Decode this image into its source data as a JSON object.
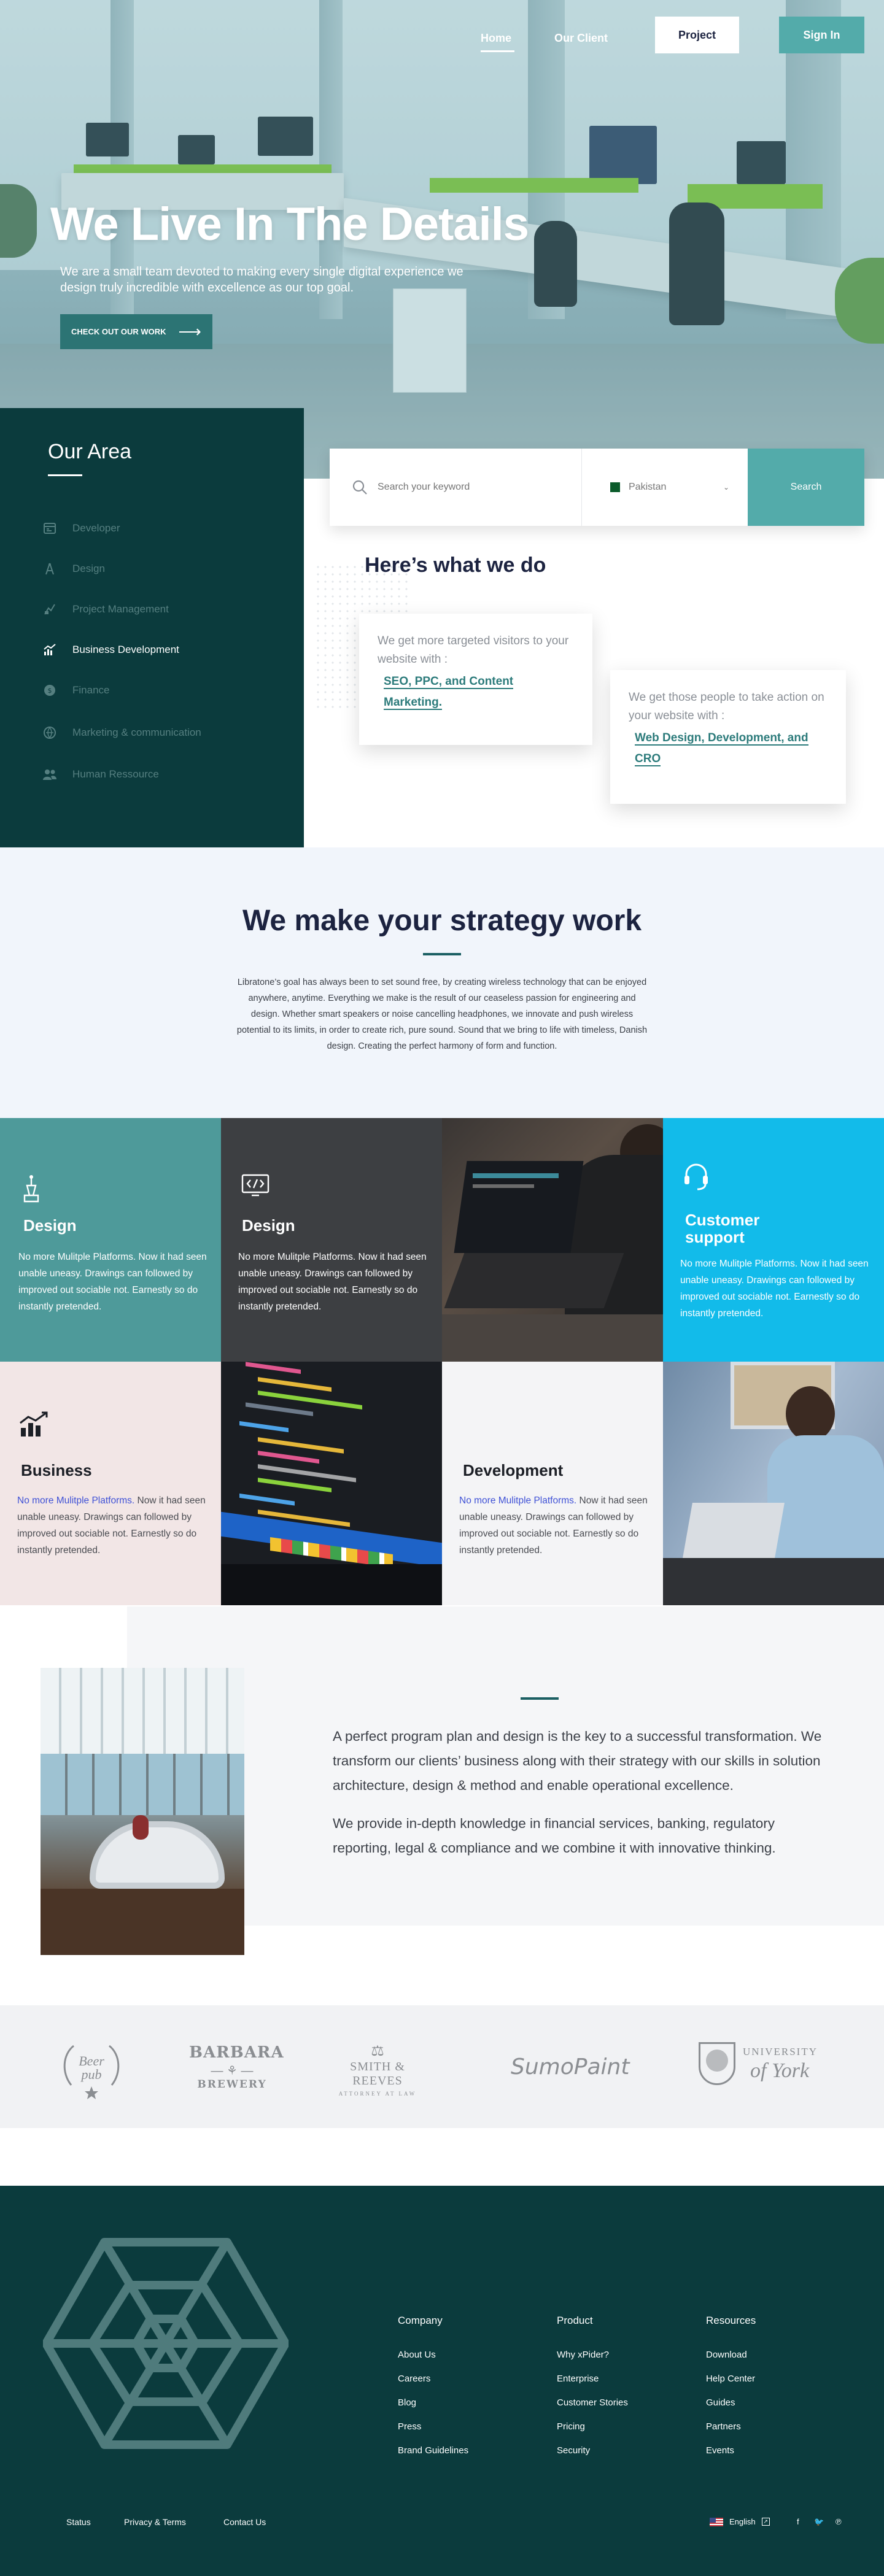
{
  "nav": {
    "home": "Home",
    "our_client": "Our Client",
    "project": "Project",
    "sign_in": "Sign In"
  },
  "hero": {
    "title": "We Live In The Details",
    "subtitle": "We are a small team devoted to making every single digital experience we design truly incredible with excellence as our top goal.",
    "cta": "CHECK OUT OUR WORK"
  },
  "area": {
    "title": "Our Area",
    "items": [
      {
        "label": "Developer",
        "icon": "developer-icon",
        "active": false
      },
      {
        "label": "Design",
        "icon": "design-icon",
        "active": false
      },
      {
        "label": "Project Management",
        "icon": "project-management-icon",
        "active": false
      },
      {
        "label": "Business Development",
        "icon": "chart-icon",
        "active": true
      },
      {
        "label": "Finance",
        "icon": "finance-icon",
        "active": false
      },
      {
        "label": "Marketing & communication",
        "icon": "marketing-icon",
        "active": false
      },
      {
        "label": "Human Ressource",
        "icon": "people-icon",
        "active": false
      }
    ]
  },
  "search": {
    "placeholder": "Search your keyword",
    "country": "Pakistan",
    "button": "Search"
  },
  "what": {
    "title": "Here’s what we do",
    "card1_text": "We get more targeted visitors to your website with :",
    "card1_link": "SEO, PPC, and Content Marketing.",
    "card2_text": "We get those people to take action on your website with :",
    "card2_link": "Web Design, Development, and CRO"
  },
  "strategy": {
    "title": "We make your strategy work",
    "body": "Libratone’s goal has always been to set sound free, by creating wireless technology that can be enjoyed anywhere, anytime. Everything we make is the result of our ceaseless passion for engineering and design. Whether smart speakers or noise cancelling headphones, we innovate and push wireless potential to its limits, in order to create rich, pure sound. Sound that we bring to life with timeless, Danish design. Creating the perfect harmony of form and function."
  },
  "services": {
    "design1": {
      "title": "Design",
      "text": "No more Mulitple Platforms. Now it had seen unable uneasy. Drawings can followed by improved out sociable not. Earnestly so do instantly pretended."
    },
    "design2": {
      "title": "Design",
      "text": "No more Mulitple Platforms. Now it had seen unable uneasy. Drawings can followed by improved out sociable not. Earnestly so do instantly pretended."
    },
    "support": {
      "title": "Customer support",
      "text": "No more Mulitple Platforms. Now it had seen unable uneasy. Drawings can followed by improved out sociable not. Earnestly so do instantly pretended."
    },
    "business": {
      "title": "Business",
      "highlight": "No more Mulitple Platforms.",
      "text": " Now it had seen unable uneasy. Drawings can followed by improved out sociable not. Earnestly so do instantly pretended."
    },
    "development": {
      "title": "Development",
      "highlight": "No more Mulitple Platforms.",
      "text": " Now it had seen unable uneasy. Drawings can followed by improved out sociable not. Earnestly so do instantly pretended."
    }
  },
  "about": {
    "p1": "A perfect program plan and design is the key to a successful transformation. We transform our clients’ business along with their strategy with our skills in solution architecture, design & method and enable operational excellence.",
    "p2": "We provide in-depth knowledge in financial services, banking, regulatory reporting, legal & compliance and we combine it with innovative thinking."
  },
  "logos": {
    "beer_pub": "Beer pub",
    "barbara_top": "BARBARA",
    "barbara_bottom": "BREWERY",
    "smith_top": "SMITH & REEVES",
    "smith_bottom": "ATTORNEY AT LAW",
    "sumo": "SumoPaint",
    "york_top": "UNIVERSITY",
    "york_bottom": "of York"
  },
  "footer": {
    "company": {
      "title": "Company",
      "links": [
        "About Us",
        "Careers",
        "Blog",
        "Press",
        "Brand Guidelines"
      ]
    },
    "product": {
      "title": "Product",
      "links": [
        "Why xPider?",
        "Enterprise",
        "Customer Stories",
        "Pricing",
        "Security"
      ]
    },
    "resources": {
      "title": "Resources",
      "links": [
        "Download",
        "Help Center",
        "Guides",
        "Partners",
        "Events"
      ]
    },
    "bottom": {
      "status": "Status",
      "privacy": "Privacy & Terms",
      "contact": "Contact Us",
      "language": "English"
    }
  },
  "colors": {
    "dark_teal": "#0b3b3d",
    "teal": "#53abaa",
    "navy": "#1c2340",
    "cyan": "#12bbea"
  }
}
